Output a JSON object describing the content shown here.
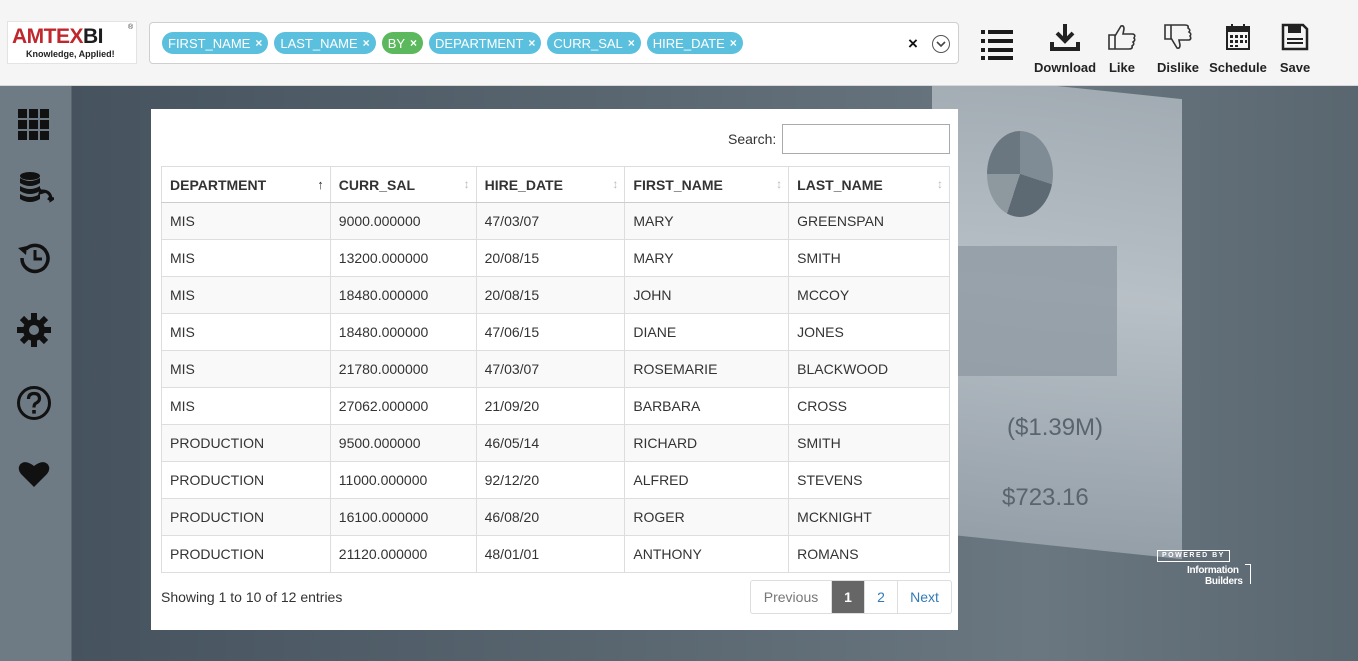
{
  "logo": {
    "brand_red": "AMTEX",
    "brand_dark": "BI",
    "registered": "®",
    "tagline": "Knowledge, Applied!"
  },
  "filter_chips": [
    {
      "label": "FIRST_NAME",
      "remove": "×"
    },
    {
      "label": "LAST_NAME",
      "remove": "×"
    },
    {
      "label": "BY",
      "remove": "×"
    },
    {
      "label": "DEPARTMENT",
      "remove": "×"
    },
    {
      "label": "CURR_SAL",
      "remove": "×"
    },
    {
      "label": "HIRE_DATE",
      "remove": "×"
    }
  ],
  "filter_clear": "×",
  "toolbar": {
    "download": "Download",
    "like": "Like",
    "dislike": "Dislike",
    "schedule": "Schedule",
    "save": "Save"
  },
  "colors": {
    "chip": "#5bc0de",
    "chip_by": "#5cb85c",
    "active_page": "#666666"
  },
  "background": {
    "value1": "($1.39M)",
    "value2": "$723.16"
  },
  "powered": {
    "line1": "POWERED BY",
    "line2": "Information",
    "line3": "Builders"
  },
  "search": {
    "label": "Search:",
    "value": ""
  },
  "table": {
    "columns": [
      "DEPARTMENT",
      "CURR_SAL",
      "HIRE_DATE",
      "FIRST_NAME",
      "LAST_NAME"
    ],
    "sort_icons": [
      "↑",
      "↕",
      "↕",
      "↕",
      "↕"
    ],
    "rows": [
      [
        "MIS",
        "9000.000000",
        "47/03/07",
        "MARY",
        "GREENSPAN"
      ],
      [
        "MIS",
        "13200.000000",
        "20/08/15",
        "MARY",
        "SMITH"
      ],
      [
        "MIS",
        "18480.000000",
        "20/08/15",
        "JOHN",
        "MCCOY"
      ],
      [
        "MIS",
        "18480.000000",
        "47/06/15",
        "DIANE",
        "JONES"
      ],
      [
        "MIS",
        "21780.000000",
        "47/03/07",
        "ROSEMARIE",
        "BLACKWOOD"
      ],
      [
        "MIS",
        "27062.000000",
        "21/09/20",
        "BARBARA",
        "CROSS"
      ],
      [
        "PRODUCTION",
        "9500.000000",
        "46/05/14",
        "RICHARD",
        "SMITH"
      ],
      [
        "PRODUCTION",
        "11000.000000",
        "92/12/20",
        "ALFRED",
        "STEVENS"
      ],
      [
        "PRODUCTION",
        "16100.000000",
        "46/08/20",
        "ROGER",
        "MCKNIGHT"
      ],
      [
        "PRODUCTION",
        "21120.000000",
        "48/01/01",
        "ANTHONY",
        "ROMANS"
      ]
    ]
  },
  "info": "Showing 1 to 10 of 12 entries",
  "pagination": {
    "previous": "Previous",
    "page1": "1",
    "page2": "2",
    "next": "Next"
  }
}
